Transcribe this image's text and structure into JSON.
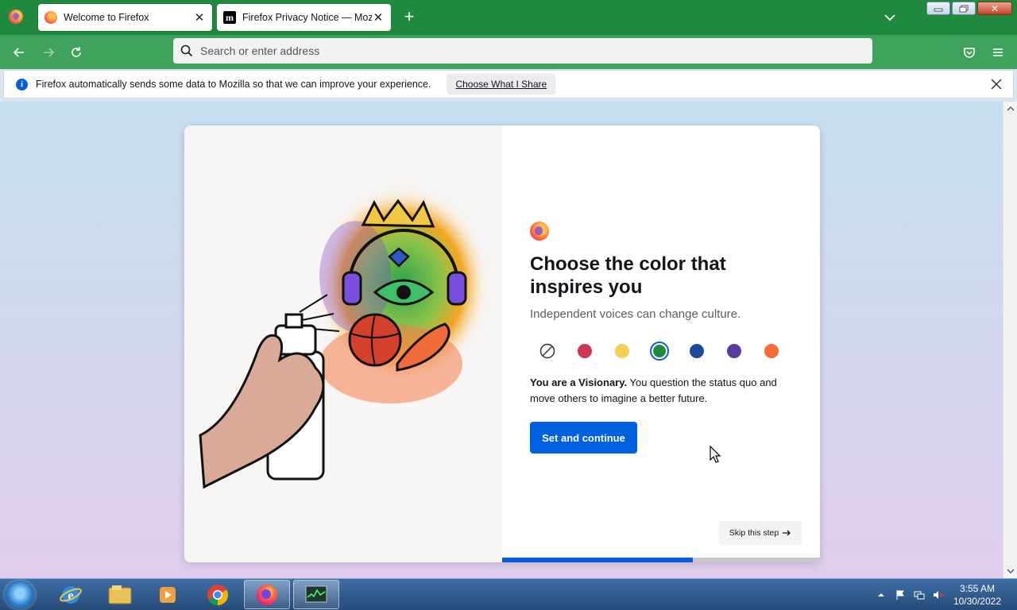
{
  "tabs": [
    {
      "title": "Welcome to Firefox",
      "favicon": "firefox-icon",
      "active": true
    },
    {
      "title": "Firefox Privacy Notice — Mozilla",
      "favicon": "mozilla-icon",
      "active": false
    }
  ],
  "urlbar": {
    "placeholder": "Search or enter address"
  },
  "notification": {
    "message": "Firefox automatically sends some data to Mozilla so that we can improve your experience.",
    "button": "Choose What I Share"
  },
  "onboarding": {
    "title": "Choose the color that inspires you",
    "subtitle": "Independent voices can change culture.",
    "colors": [
      {
        "name": "none",
        "hex": "#ffffff"
      },
      {
        "name": "red",
        "hex": "#d0344f"
      },
      {
        "name": "yellow",
        "hex": "#f2cf55"
      },
      {
        "name": "green",
        "hex": "#1f8a3d"
      },
      {
        "name": "blue",
        "hex": "#1d4b9b"
      },
      {
        "name": "purple",
        "hex": "#5b3ba0"
      },
      {
        "name": "orange",
        "hex": "#f76a39"
      }
    ],
    "selected_color": "green",
    "desc_bold": "You are a Visionary.",
    "desc_rest": " You question the status quo and move others to imagine a better future.",
    "primary_button": "Set and continue",
    "skip_button": "Skip this step",
    "progress": 0.6
  },
  "taskbar": {
    "time": "3:55 AM",
    "date": "10/30/2022",
    "apps": [
      "internet-explorer-icon",
      "file-explorer-icon",
      "media-player-icon",
      "chrome-icon",
      "firefox-icon",
      "task-manager-icon"
    ]
  },
  "colors": {
    "tabstrip": "#1f8a3d",
    "navbar": "#3fa35d",
    "accent": "#0060df"
  }
}
